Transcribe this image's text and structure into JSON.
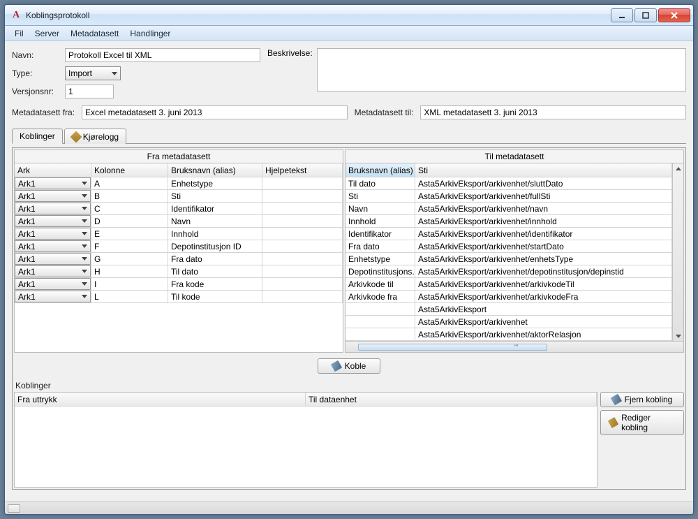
{
  "window": {
    "title": "Koblingsprotokoll"
  },
  "menu": {
    "items": [
      "Fil",
      "Server",
      "Metadatasett",
      "Handlinger"
    ]
  },
  "form": {
    "navn_label": "Navn:",
    "navn_value": "Protokoll Excel til XML",
    "type_label": "Type:",
    "type_value": "Import",
    "versjon_label": "Versjonsnr:",
    "versjon_value": "1",
    "beskrivelse_label": "Beskrivelse:",
    "beskrivelse_value": "",
    "meta_fra_label": "Metadatasett fra:",
    "meta_fra_value": "Excel metadatasett 3. juni 2013",
    "meta_til_label": "Metadatasett til:",
    "meta_til_value": "XML metadatasett 3. juni 2013"
  },
  "tabs": {
    "koblinger": "Koblinger",
    "kjorelogg": "Kjørelogg"
  },
  "left_grid": {
    "title": "Fra metadatasett",
    "headers": {
      "ark": "Ark",
      "kolonne": "Kolonne",
      "bruksnavn": "Bruksnavn (alias)",
      "hjelpetekst": "Hjelpetekst"
    },
    "ark_option": "Ark1",
    "rows": [
      {
        "kol": "A",
        "bruk": "Enhetstype",
        "hjelp": ""
      },
      {
        "kol": "B",
        "bruk": "Sti",
        "hjelp": ""
      },
      {
        "kol": "C",
        "bruk": "Identifikator",
        "hjelp": ""
      },
      {
        "kol": "D",
        "bruk": "Navn",
        "hjelp": ""
      },
      {
        "kol": "E",
        "bruk": "Innhold",
        "hjelp": ""
      },
      {
        "kol": "F",
        "bruk": "Depotinstitusjon ID",
        "hjelp": ""
      },
      {
        "kol": "G",
        "bruk": "Fra dato",
        "hjelp": ""
      },
      {
        "kol": "H",
        "bruk": "Til dato",
        "hjelp": ""
      },
      {
        "kol": "I",
        "bruk": "Fra kode",
        "hjelp": ""
      },
      {
        "kol": "L",
        "bruk": "Til kode",
        "hjelp": ""
      }
    ]
  },
  "right_grid": {
    "title": "Til metadatasett",
    "headers": {
      "bruksnavn": "Bruksnavn (alias)",
      "sti": "Sti"
    },
    "rows": [
      {
        "bruk": "Til dato",
        "sti": "Asta5ArkivEksport/arkivenhet/sluttDato"
      },
      {
        "bruk": "Sti",
        "sti": "Asta5ArkivEksport/arkivenhet/fullSti"
      },
      {
        "bruk": "Navn",
        "sti": "Asta5ArkivEksport/arkivenhet/navn"
      },
      {
        "bruk": "Innhold",
        "sti": "Asta5ArkivEksport/arkivenhet/innhold"
      },
      {
        "bruk": "Identifikator",
        "sti": "Asta5ArkivEksport/arkivenhet/identifikator"
      },
      {
        "bruk": "Fra dato",
        "sti": "Asta5ArkivEksport/arkivenhet/startDato"
      },
      {
        "bruk": "Enhetstype",
        "sti": "Asta5ArkivEksport/arkivenhet/enhetsType"
      },
      {
        "bruk": "Depotinstitusjons...",
        "sti": "Asta5ArkivEksport/arkivenhet/depotinstitusjon/depinstid"
      },
      {
        "bruk": "Arkivkode til",
        "sti": "Asta5ArkivEksport/arkivenhet/arkivkodeTil"
      },
      {
        "bruk": "Arkivkode fra",
        "sti": "Asta5ArkivEksport/arkivenhet/arkivkodeFra"
      },
      {
        "bruk": "",
        "sti": "Asta5ArkivEksport"
      },
      {
        "bruk": "",
        "sti": "Asta5ArkivEksport/arkivenhet"
      },
      {
        "bruk": "",
        "sti": "Asta5ArkivEksport/arkivenhet/aktorRelasjon"
      }
    ]
  },
  "buttons": {
    "koble": "Koble",
    "fjern": "Fjern kobling",
    "rediger": "Rediger kobling"
  },
  "bottom": {
    "label": "Koblinger",
    "headers": {
      "fra": "Fra uttrykk",
      "til": "Til dataenhet"
    }
  },
  "hscroll_tick": "'''"
}
